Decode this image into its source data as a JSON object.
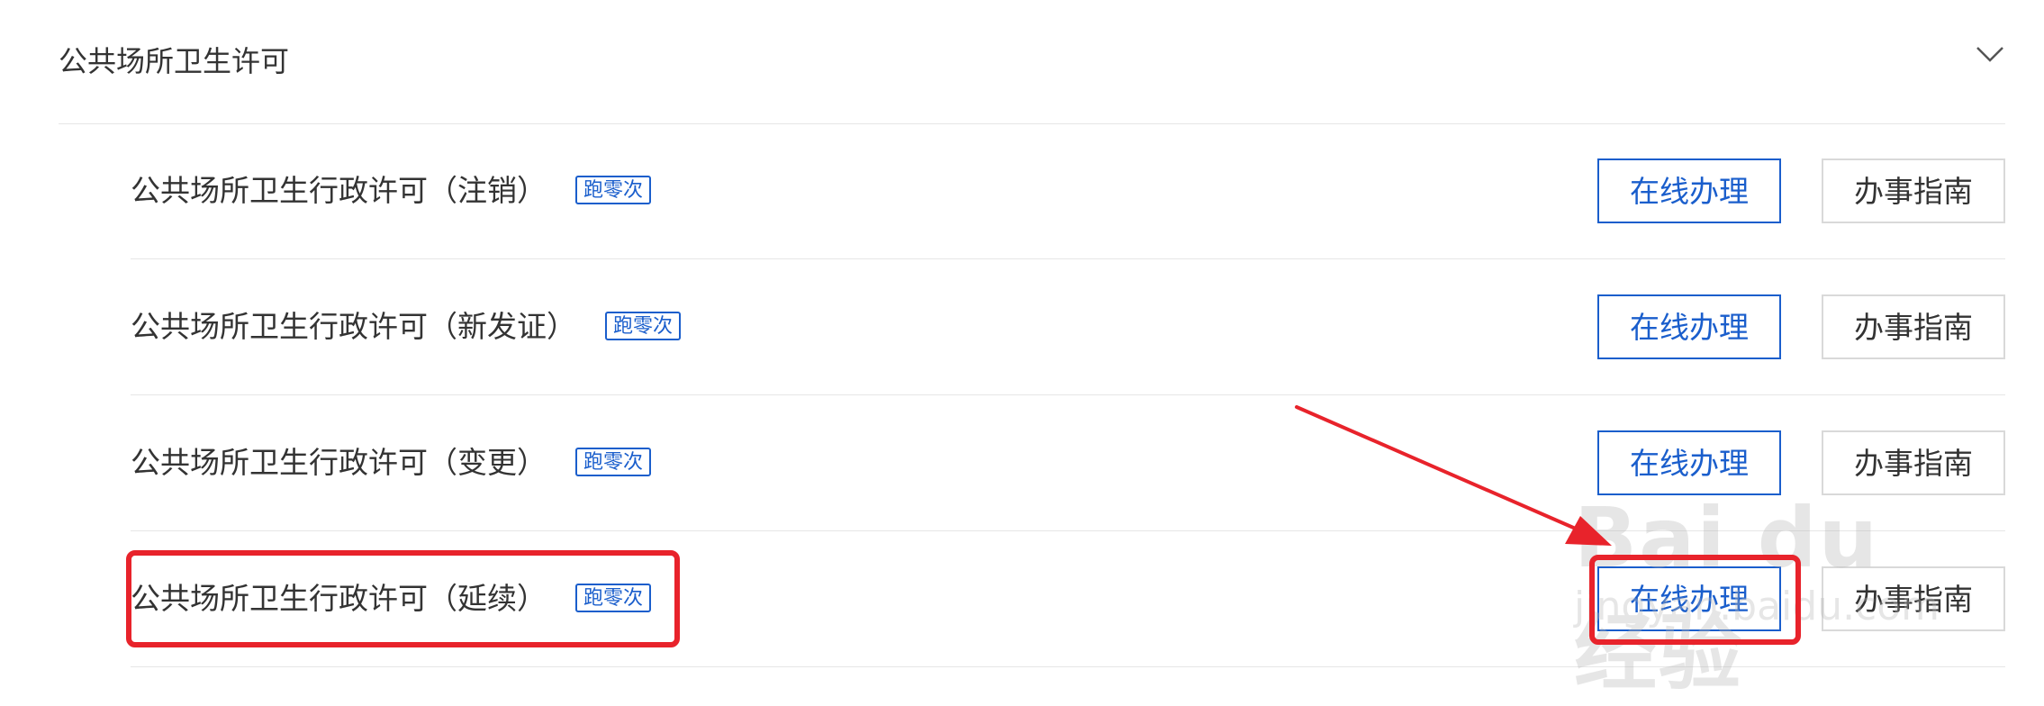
{
  "section": {
    "title": "公共场所卫生许可",
    "toggle_icon": "chevron-down-icon"
  },
  "items": [
    {
      "label": "公共场所卫生行政许可（注销）",
      "badge": "跑零次",
      "online_label": "在线办理",
      "guide_label": "办事指南"
    },
    {
      "label": "公共场所卫生行政许可（新发证）",
      "badge": "跑零次",
      "online_label": "在线办理",
      "guide_label": "办事指南"
    },
    {
      "label": "公共场所卫生行政许可（变更）",
      "badge": "跑零次",
      "online_label": "在线办理",
      "guide_label": "办事指南"
    },
    {
      "label": "公共场所卫生行政许可（延续）",
      "badge": "跑零次",
      "online_label": "在线办理",
      "guide_label": "办事指南"
    }
  ],
  "annotation": {
    "color": "#e8232b",
    "highlighted_item": "公共场所卫生行政许可（延续）",
    "highlighted_button": "在线办理"
  },
  "watermark": {
    "brand": "Bai du 经验",
    "url": "jingyan.baidu.com"
  },
  "colors": {
    "accent": "#1a5ecc",
    "text": "#333333",
    "divider": "#e6e6e6",
    "guide_border": "#d9d9d9"
  }
}
